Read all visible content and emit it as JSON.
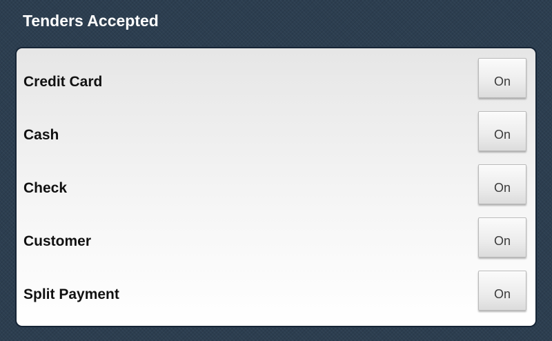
{
  "header": {
    "title": "Tenders Accepted"
  },
  "tenders": [
    {
      "label": "Credit Card",
      "state": "On"
    },
    {
      "label": "Cash",
      "state": "On"
    },
    {
      "label": "Check",
      "state": "On"
    },
    {
      "label": "Customer",
      "state": "On"
    },
    {
      "label": "Split Payment",
      "state": "On"
    }
  ],
  "colors": {
    "background": "#2c3e50",
    "panel_border": "#162536",
    "title_text": "#ffffff",
    "label_text": "#111111",
    "button_text": "#3a3a3a"
  }
}
